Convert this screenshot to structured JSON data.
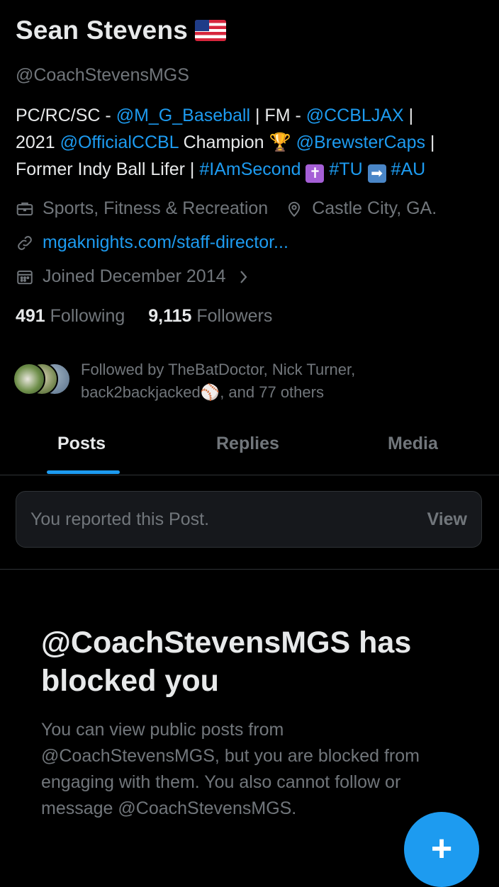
{
  "profile": {
    "name": "Sean Stevens",
    "handle": "@CoachStevensMGS",
    "bio": {
      "l1_a": "PC/RC/SC - ",
      "l1_link1": "@M_G_Baseball",
      "l1_b": " | FM - ",
      "l1_link2": "@CCBLJAX",
      "l1_c": " |",
      "l2_a": "2021 ",
      "l2_link1": "@OfficialCCBL",
      "l2_b": " Champion ",
      "l2_trophy": "🏆",
      "l2_link2": " @BrewsterCaps",
      "l2_c": " |",
      "l3_a": "Former Indy Ball Lifer | ",
      "l3_tag1": "#IAmSecond",
      "l3_cross": "✝",
      "l3_tag2": " #TU",
      "l3_arrow": "➡",
      "l3_tag3": " #AU"
    },
    "category": "Sports, Fitness & Recreation",
    "location": "Castle City, GA.",
    "website": "mgaknights.com/staff-director...",
    "joined": "Joined December 2014",
    "following_count": "491",
    "following_label": " Following",
    "followers_count": "9,115",
    "followers_label": " Followers",
    "followed_by_line1": "Followed by TheBatDoctor, Nick Turner,",
    "followed_by_line2": "back2backjacked",
    "followed_by_baseball": "⚾",
    "followed_by_line2_end": ", and 77 others"
  },
  "tabs": [
    {
      "label": "Posts"
    },
    {
      "label": "Replies"
    },
    {
      "label": "Media"
    }
  ],
  "report": {
    "text": "You reported this Post.",
    "view_label": "View"
  },
  "blocked": {
    "title": "@CoachStevensMGS has blocked you",
    "body": "You can view public posts from @CoachStevensMGS, but you are blocked from engaging with them. You also cannot follow or message @CoachStevensMGS."
  },
  "fab": {
    "label": "+"
  },
  "icons": {
    "category": "briefcase-icon",
    "location": "map-pin-icon",
    "website": "link-icon",
    "joined": "calendar-icon",
    "joined_chevron": "chevron-right-icon"
  },
  "colors": {
    "accent": "#1d9bf0",
    "background": "#000000",
    "muted": "#71767b"
  }
}
